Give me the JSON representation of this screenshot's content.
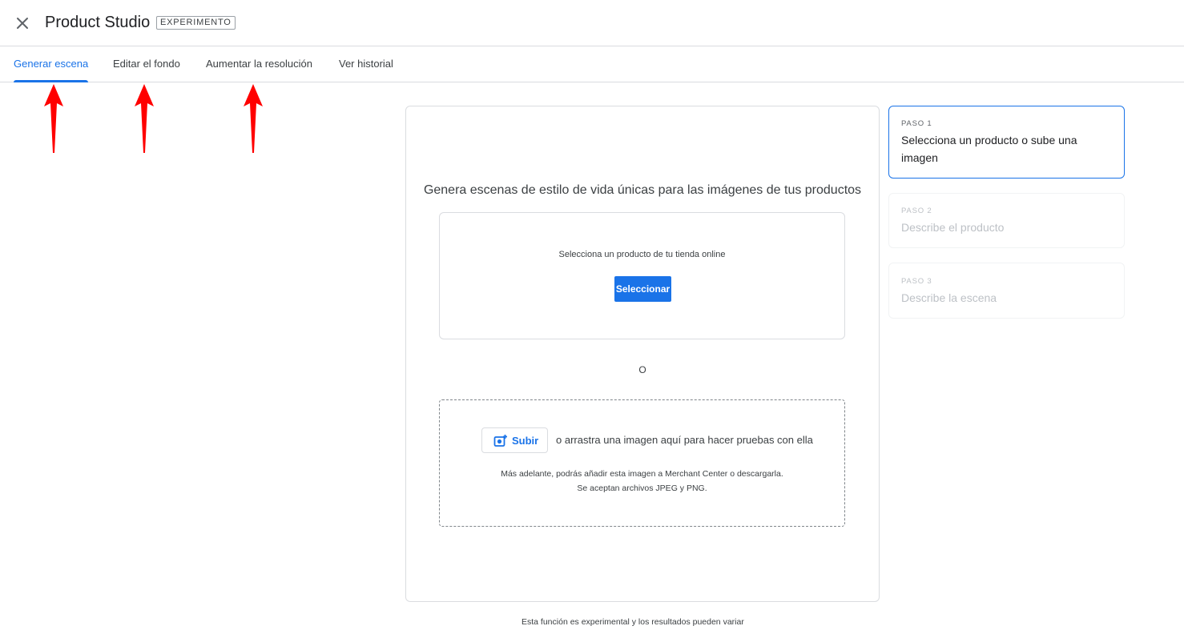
{
  "header": {
    "title": "Product Studio",
    "badge": "EXPERIMENTO"
  },
  "tabs": [
    {
      "label": "Generar escena",
      "active": true
    },
    {
      "label": "Editar el fondo",
      "active": false
    },
    {
      "label": "Aumentar la resolución",
      "active": false
    },
    {
      "label": "Ver historial",
      "active": false
    }
  ],
  "main": {
    "heading": "Genera escenas de estilo de vida únicas para las imágenes de tus productos",
    "select_box": {
      "text": "Selecciona un producto de tu tienda online",
      "button_label": "Seleccionar"
    },
    "or_text": "O",
    "upload_box": {
      "button_label": "Subir",
      "drag_text": "o arrastra una imagen aquí para hacer pruebas con ella",
      "note_line1": "Más adelante, podrás añadir esta imagen a Merchant Center o descargarla.",
      "note_line2": "Se aceptan archivos JPEG y PNG."
    }
  },
  "steps": [
    {
      "number": "PASO 1",
      "title": "Selecciona un producto o sube una imagen",
      "active": true
    },
    {
      "number": "PASO 2",
      "title": "Describe el producto",
      "active": false
    },
    {
      "number": "PASO 3",
      "title": "Describe la escena",
      "active": false
    }
  ],
  "footer": {
    "text": "Esta función es experimental y los resultados pueden variar"
  },
  "colors": {
    "accent": "#1a73e8",
    "annotation_arrow": "#ff0000",
    "border": "#dadce0"
  },
  "icons": {
    "close": "close-icon",
    "upload": "add-photo-icon",
    "arrow": "red-arrow-up-annotation"
  }
}
